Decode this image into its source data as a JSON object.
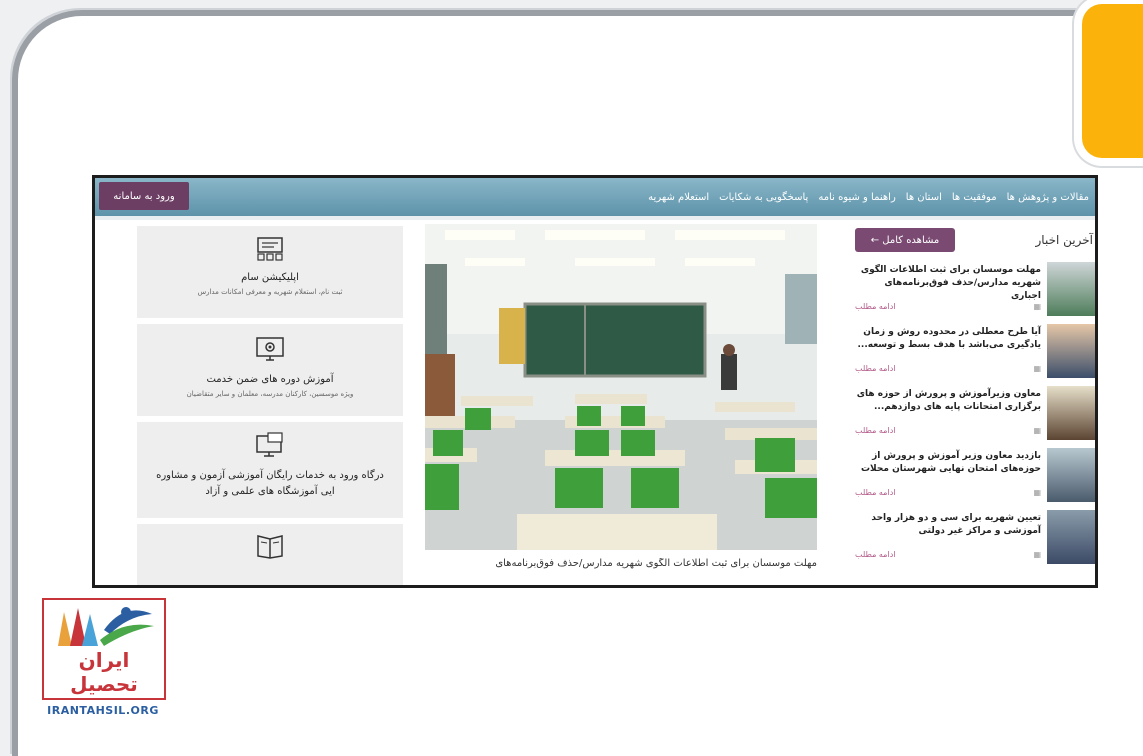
{
  "topbar": {
    "nav_items": [
      "مقالات و پژوهش ها",
      "موفقیت ها",
      "استان ها",
      "راهنما و شیوه نامه",
      "پاسخگویی به شکایات",
      "استعلام شهریه"
    ],
    "login_label": "ورود به سامانه"
  },
  "news": {
    "title": "آخرین اخبار",
    "more_label": "مشاهده کامل ←",
    "items": [
      {
        "title": "مهلت موسسان برای ثبت اطلاعات الگوی شهریه مدارس/حذف فوق‌برنامه‌های اجباری",
        "date": "",
        "more": "ادامه مطلب"
      },
      {
        "title": "آیا طرح معطلی در محدوده روش و زمان یادگیری می‌باشد با هدف بسط و توسعه...",
        "date": "",
        "more": "ادامه مطلب"
      },
      {
        "title": "معاون وزیرآموزش و پرورش از حوزه های برگزاری امتحانات پایه های دوازدهم...",
        "date": "",
        "more": "ادامه مطلب"
      },
      {
        "title": "بازدید معاون وزیر آموزش و پرورش از حوزه‌های امتحان نهایی شهرستان محلات",
        "date": "",
        "more": "ادامه مطلب"
      },
      {
        "title": "تعیین شهریه برای سی و دو هزار واحد آموزشی و مراکز غیر دولتی",
        "date": "",
        "more": "ادامه مطلب"
      }
    ]
  },
  "photo": {
    "caption": "مهلت موسسان برای ثبت اطلاعات الگوی شهریه مدارس/حذف فوق‌برنامه‌های"
  },
  "cards": [
    {
      "title": "اپلیکیشن سام",
      "subtitle": "ثبت نام، استعلام شهریه و معرفی امکانات مدارس",
      "icon": "app-grid-icon"
    },
    {
      "title": "آموزش دوره های ضمن خدمت",
      "subtitle": "ویژه موسسین، کارکنان مدرسه، معلمان و سایر متقاضیان",
      "icon": "monitor-gear-icon"
    },
    {
      "title": "درگاه ورود به خدمات رایگان آموزشی آزمون و مشاوره",
      "title2": "ایی آموزشگاه های علمی و آزاد",
      "subtitle": "",
      "icon": "monitor-chat-icon"
    },
    {
      "title": "",
      "subtitle": "",
      "icon": "book-icon"
    }
  ],
  "logo": {
    "name": "ایران تحصیل",
    "url": "IRANTAHSIL.ORG"
  },
  "colors": {
    "topbar": "#6a9fb6",
    "login_button": "#6c3e63",
    "accent_tab": "#fbb30b",
    "logo_red": "#c7343a",
    "logo_blue": "#2b5fa2"
  }
}
